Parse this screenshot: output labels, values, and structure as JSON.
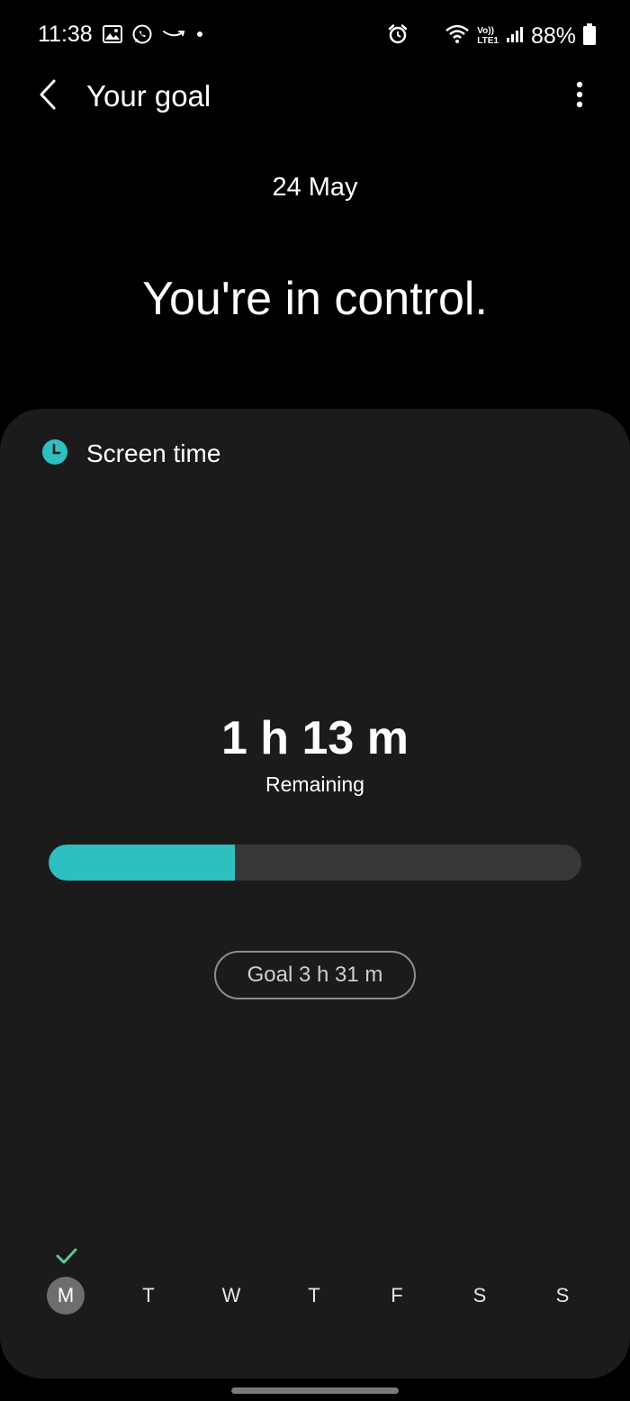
{
  "status_bar": {
    "time": "11:38",
    "left_icons": [
      "gallery-icon",
      "whatsapp-icon",
      "amazon-icon",
      "dot-icon"
    ],
    "right_icons": [
      "alarm-icon",
      "wifi-icon",
      "volte-lte-icon",
      "signal-icon",
      "battery-icon"
    ],
    "network_label_top": "Vo))",
    "network_label_bottom": "LTE1",
    "battery_percent": "88%"
  },
  "app_bar": {
    "title": "Your goal",
    "back_icon": "chevron-left-icon",
    "more_icon": "more-vertical-icon"
  },
  "header": {
    "date": "24 May",
    "headline": "You're in control."
  },
  "card": {
    "icon": "clock-icon",
    "title": "Screen time",
    "remaining_value": "1 h 13 m",
    "remaining_label": "Remaining",
    "progress_fraction": 0.35,
    "goal_label": "Goal 3 h 31 m"
  },
  "week": {
    "days": [
      "M",
      "T",
      "W",
      "T",
      "F",
      "S",
      "S"
    ],
    "active_index": 0,
    "checked_indices": [
      0
    ]
  },
  "colors": {
    "accent": "#2ebfc1",
    "check": "#5cc98f",
    "background": "#000000",
    "card": "#1b1b1b",
    "track": "#373737"
  }
}
